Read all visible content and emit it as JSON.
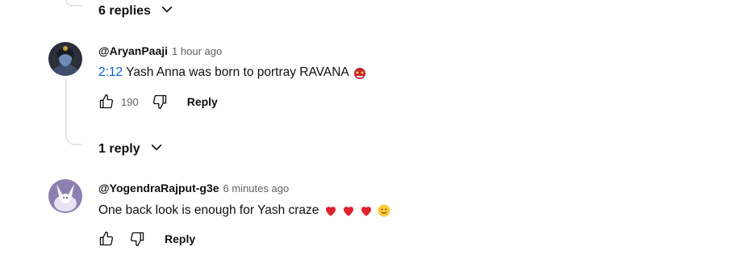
{
  "top_toggle": {
    "label": "6 replies"
  },
  "comments": [
    {
      "author": "@AryanPaaji",
      "time": "1 hour ago",
      "timestamp_link": "2:12",
      "text": "Yash Anna was born to portray RAVANA",
      "emojis": [
        "ogre-mask-emoji"
      ],
      "likes": "190",
      "reply_label": "Reply",
      "replies_toggle": "1 reply"
    },
    {
      "author": "@YogendraRajput-g3e",
      "time": "6 minutes ago",
      "text": "One back look is enough for Yash craze",
      "emojis": [
        "red-heart-emoji",
        "red-heart-emoji",
        "red-heart-emoji",
        "smiling-face-emoji"
      ],
      "likes": "",
      "reply_label": "Reply"
    }
  ],
  "colors": {
    "link": "#065fd4",
    "secondary_text": "#606060",
    "thread_line": "#e5e5e5",
    "heart": "#e0202e"
  }
}
